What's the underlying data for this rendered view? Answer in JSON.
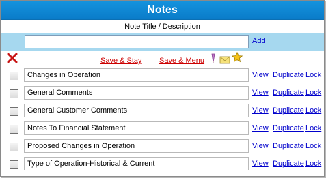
{
  "title": "Notes",
  "column_header": "Note Title / Description",
  "add": {
    "input_value": "",
    "link_label": "Add"
  },
  "toolbar": {
    "save_stay": "Save & Stay",
    "separator": "|",
    "save_menu": "Save & Menu",
    "icons": [
      "delete-x-icon",
      "pencil-icon",
      "envelope-icon",
      "star-icon"
    ]
  },
  "notes": [
    {
      "title": "Changes in Operation",
      "view": "View",
      "duplicate": "Duplicate",
      "lock": "Lock"
    },
    {
      "title": "General Comments",
      "view": "View",
      "duplicate": "Duplicate",
      "lock": "Lock"
    },
    {
      "title": "General Customer Comments",
      "view": "View",
      "duplicate": "Duplicate",
      "lock": "Lock"
    },
    {
      "title": "Notes To Financial Statement",
      "view": "View",
      "duplicate": "Duplicate",
      "lock": "Lock"
    },
    {
      "title": "Proposed Changes in Operation",
      "view": "View",
      "duplicate": "Duplicate",
      "lock": "Lock"
    },
    {
      "title": "Type of Operation-Historical & Current",
      "view": "View",
      "duplicate": "Duplicate",
      "lock": "Lock"
    }
  ],
  "colors": {
    "title_bar": "#0a7cc9",
    "add_band": "#a6d8ef",
    "save_link": "#cc0000",
    "link": "#0000cc"
  }
}
